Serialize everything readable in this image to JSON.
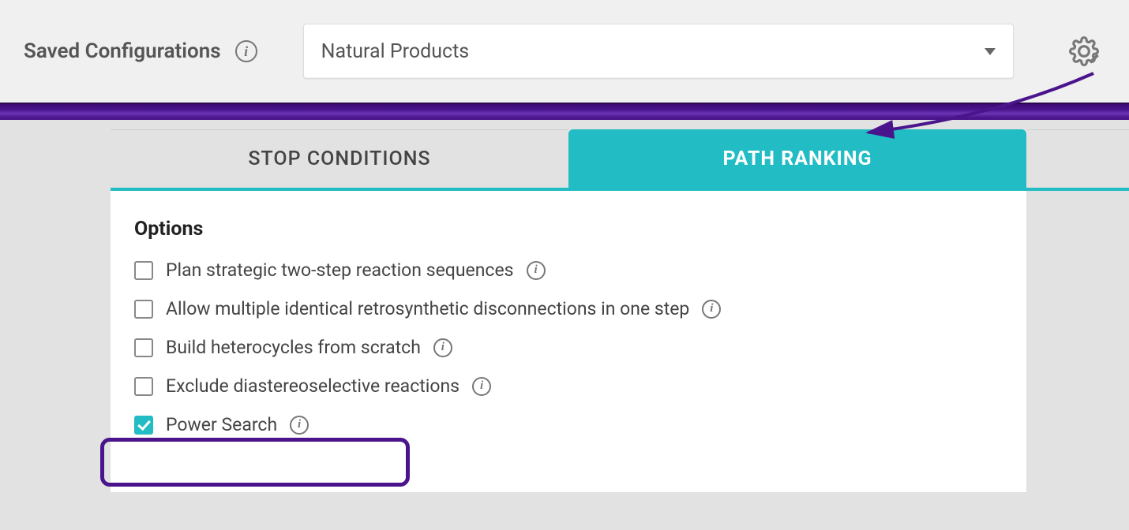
{
  "header": {
    "label": "Saved Configurations",
    "dropdown_value": "Natural Products"
  },
  "tabs": {
    "stop_conditions": "STOP CONDITIONS",
    "path_ranking": "PATH RANKING",
    "active": "path_ranking"
  },
  "options": {
    "title": "Options",
    "items": [
      {
        "label": "Plan strategic two-step reaction sequences",
        "checked": false
      },
      {
        "label": "Allow multiple identical retrosynthetic disconnections in one step",
        "checked": false
      },
      {
        "label": "Build heterocycles from scratch",
        "checked": false
      },
      {
        "label": "Exclude diastereoselective reactions",
        "checked": false
      },
      {
        "label": "Power Search",
        "checked": true,
        "highlighted": true
      }
    ]
  },
  "colors": {
    "accent_teal": "#22bcc4",
    "accent_purple": "#4a148c"
  }
}
